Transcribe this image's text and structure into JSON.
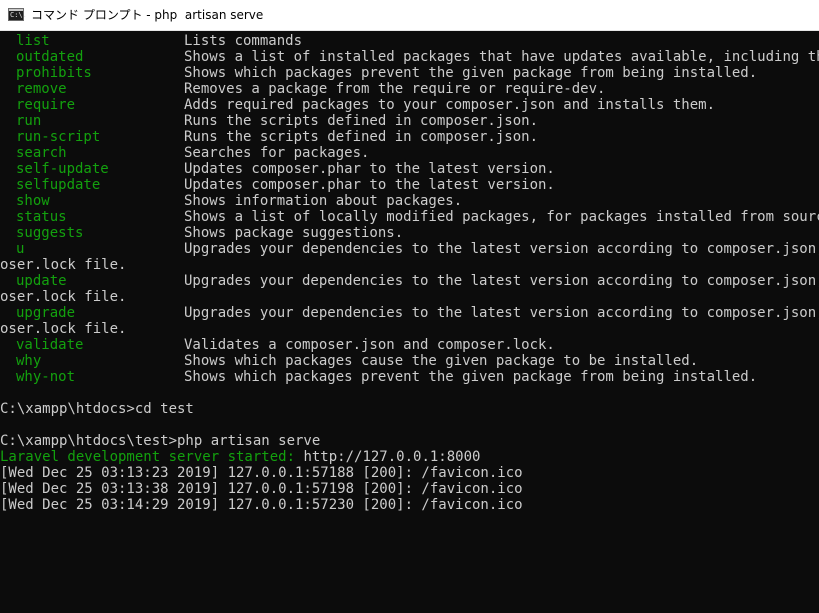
{
  "window": {
    "title": "コマンド プロンプト - php  artisan serve",
    "icon_label": "C:\\."
  },
  "commands": [
    {
      "name": "list",
      "desc": "Lists commands"
    },
    {
      "name": "outdated",
      "desc": "Shows a list of installed packages that have updates available, including their"
    },
    {
      "name": "prohibits",
      "desc": "Shows which packages prevent the given package from being installed."
    },
    {
      "name": "remove",
      "desc": "Removes a package from the require or require-dev."
    },
    {
      "name": "require",
      "desc": "Adds required packages to your composer.json and installs them."
    },
    {
      "name": "run",
      "desc": "Runs the scripts defined in composer.json."
    },
    {
      "name": "run-script",
      "desc": "Runs the scripts defined in composer.json."
    },
    {
      "name": "search",
      "desc": "Searches for packages."
    },
    {
      "name": "self-update",
      "desc": "Updates composer.phar to the latest version."
    },
    {
      "name": "selfupdate",
      "desc": "Updates composer.phar to the latest version."
    },
    {
      "name": "show",
      "desc": "Shows information about packages."
    },
    {
      "name": "status",
      "desc": "Shows a list of locally modified packages, for packages installed from source."
    },
    {
      "name": "suggests",
      "desc": "Shows package suggestions."
    },
    {
      "name": "u",
      "desc": "Upgrades your dependencies to the latest version according to composer.json, and",
      "wrap": "oser.lock file."
    },
    {
      "name": "update",
      "desc": "Upgrades your dependencies to the latest version according to composer.json, and",
      "wrap": "oser.lock file."
    },
    {
      "name": "upgrade",
      "desc": "Upgrades your dependencies to the latest version according to composer.json, and",
      "wrap": "oser.lock file."
    },
    {
      "name": "validate",
      "desc": "Validates a composer.json and composer.lock."
    },
    {
      "name": "why",
      "desc": "Shows which packages cause the given package to be installed."
    },
    {
      "name": "why-not",
      "desc": "Shows which packages prevent the given package from being installed."
    }
  ],
  "prompt1": "C:\\xampp\\htdocs>cd test",
  "prompt2": "C:\\xampp\\htdocs\\test>php artisan serve",
  "server_started_label": "Laravel development server started:",
  "server_url": " http://127.0.0.1:8000",
  "log_lines": [
    "[Wed Dec 25 03:13:23 2019] 127.0.0.1:57188 [200]: /favicon.ico",
    "[Wed Dec 25 03:13:38 2019] 127.0.0.1:57198 [200]: /favicon.ico",
    "[Wed Dec 25 03:14:29 2019] 127.0.0.1:57230 [200]: /favicon.ico"
  ],
  "colors": {
    "background": "#0c0c0c",
    "text": "#cccccc",
    "command": "#13a10e"
  }
}
